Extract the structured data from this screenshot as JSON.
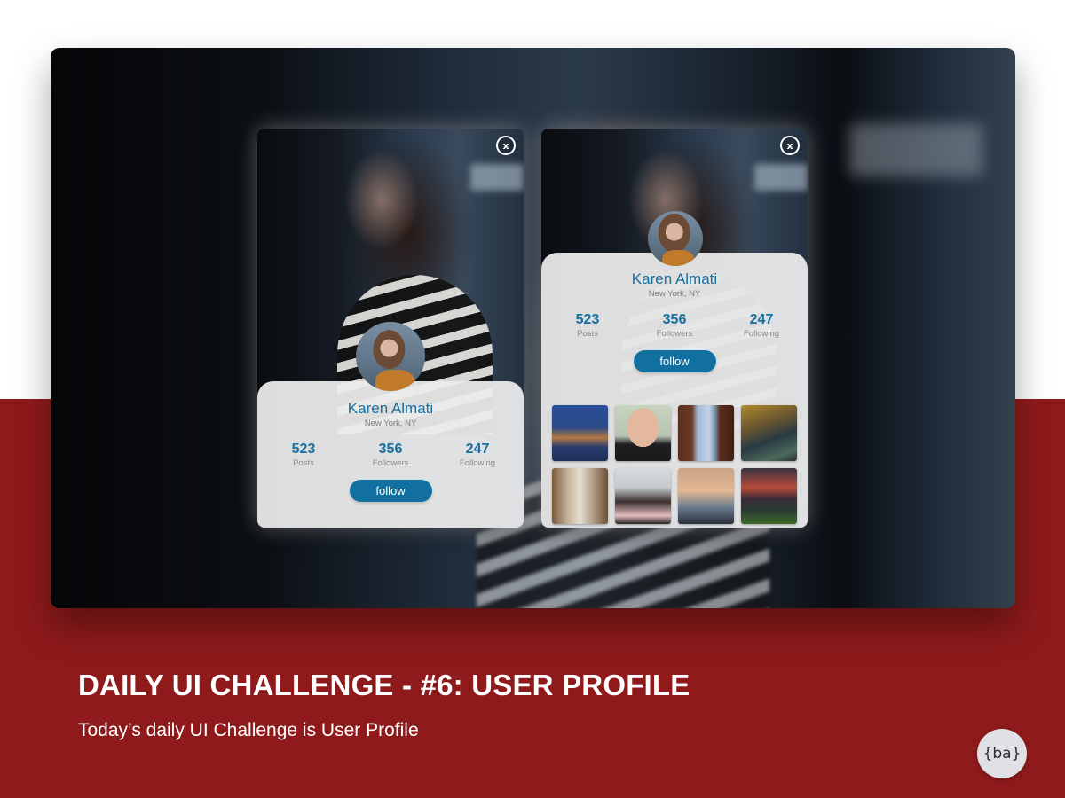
{
  "slide": {
    "headline": "DAILY UI CHALLENGE - #6: USER PROFILE",
    "subline": "Today’s daily UI Challenge is User Profile",
    "logo_text": "{ba}"
  },
  "colors": {
    "accent": "#1270a1",
    "name_text": "#1770a0",
    "band": "#8e1a1b",
    "panel": "#ebebeb"
  },
  "profile_cards": [
    {
      "variant": "compact",
      "close_label": "x",
      "name": "Karen Almati",
      "location": "New York, NY",
      "stats": [
        {
          "value": "523",
          "label": "Posts"
        },
        {
          "value": "356",
          "label": "Followers"
        },
        {
          "value": "247",
          "label": "Following"
        }
      ],
      "follow_label": "follow"
    },
    {
      "variant": "expanded",
      "close_label": "x",
      "name": "Karen Almati",
      "location": "New York, NY",
      "stats": [
        {
          "value": "523",
          "label": "Posts"
        },
        {
          "value": "356",
          "label": "Followers"
        },
        {
          "value": "247",
          "label": "Following"
        }
      ],
      "follow_label": "follow",
      "gallery": [
        {
          "subject": "coastal-village-night"
        },
        {
          "subject": "smiling-man-portrait"
        },
        {
          "subject": "bridge-between-buildings"
        },
        {
          "subject": "market-stall"
        },
        {
          "subject": "narrow-street"
        },
        {
          "subject": "friends-in-crowd"
        },
        {
          "subject": "lifeguard-tower-sunset"
        },
        {
          "subject": "stadium-sunset"
        }
      ]
    }
  ]
}
